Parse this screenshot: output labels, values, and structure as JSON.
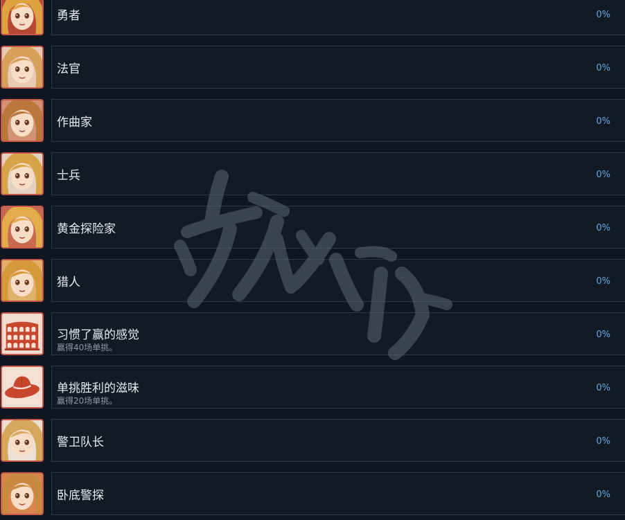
{
  "achievements": [
    {
      "title": "勇者",
      "description": "",
      "percent": "0%",
      "icon": "hero-portrait-icon",
      "icon_type": "portrait"
    },
    {
      "title": "法官",
      "description": "",
      "percent": "0%",
      "icon": "judge-portrait-icon",
      "icon_type": "portrait"
    },
    {
      "title": "作曲家",
      "description": "",
      "percent": "0%",
      "icon": "composer-portrait-icon",
      "icon_type": "portrait"
    },
    {
      "title": "士兵",
      "description": "",
      "percent": "0%",
      "icon": "soldier-portrait-icon",
      "icon_type": "portrait"
    },
    {
      "title": "黄金探险家",
      "description": "",
      "percent": "0%",
      "icon": "gold-explorer-portrait-icon",
      "icon_type": "portrait"
    },
    {
      "title": "猎人",
      "description": "",
      "percent": "0%",
      "icon": "hunter-portrait-icon",
      "icon_type": "portrait"
    },
    {
      "title": "习惯了赢的感觉",
      "description": "赢得40场单挑。",
      "percent": "0%",
      "icon": "colosseum-icon",
      "icon_type": "colosseum"
    },
    {
      "title": "单挑胜利的滋味",
      "description": "赢得20场单挑。",
      "percent": "0%",
      "icon": "cowboy-hat-icon",
      "icon_type": "hat"
    },
    {
      "title": "警卫队长",
      "description": "",
      "percent": "0%",
      "icon": "guard-captain-portrait-icon",
      "icon_type": "portrait"
    },
    {
      "title": "卧底警探",
      "description": "",
      "percent": "0%",
      "icon": "undercover-detective-portrait-icon",
      "icon_type": "portrait"
    }
  ],
  "watermark": {
    "icon": "watermark-logo-icon"
  },
  "colors": {
    "background": "#0f1620",
    "panel": "#121a24",
    "panel_border": "#2b3a48",
    "percent_text": "#62a9e6",
    "icon_border": "#c8584a"
  }
}
